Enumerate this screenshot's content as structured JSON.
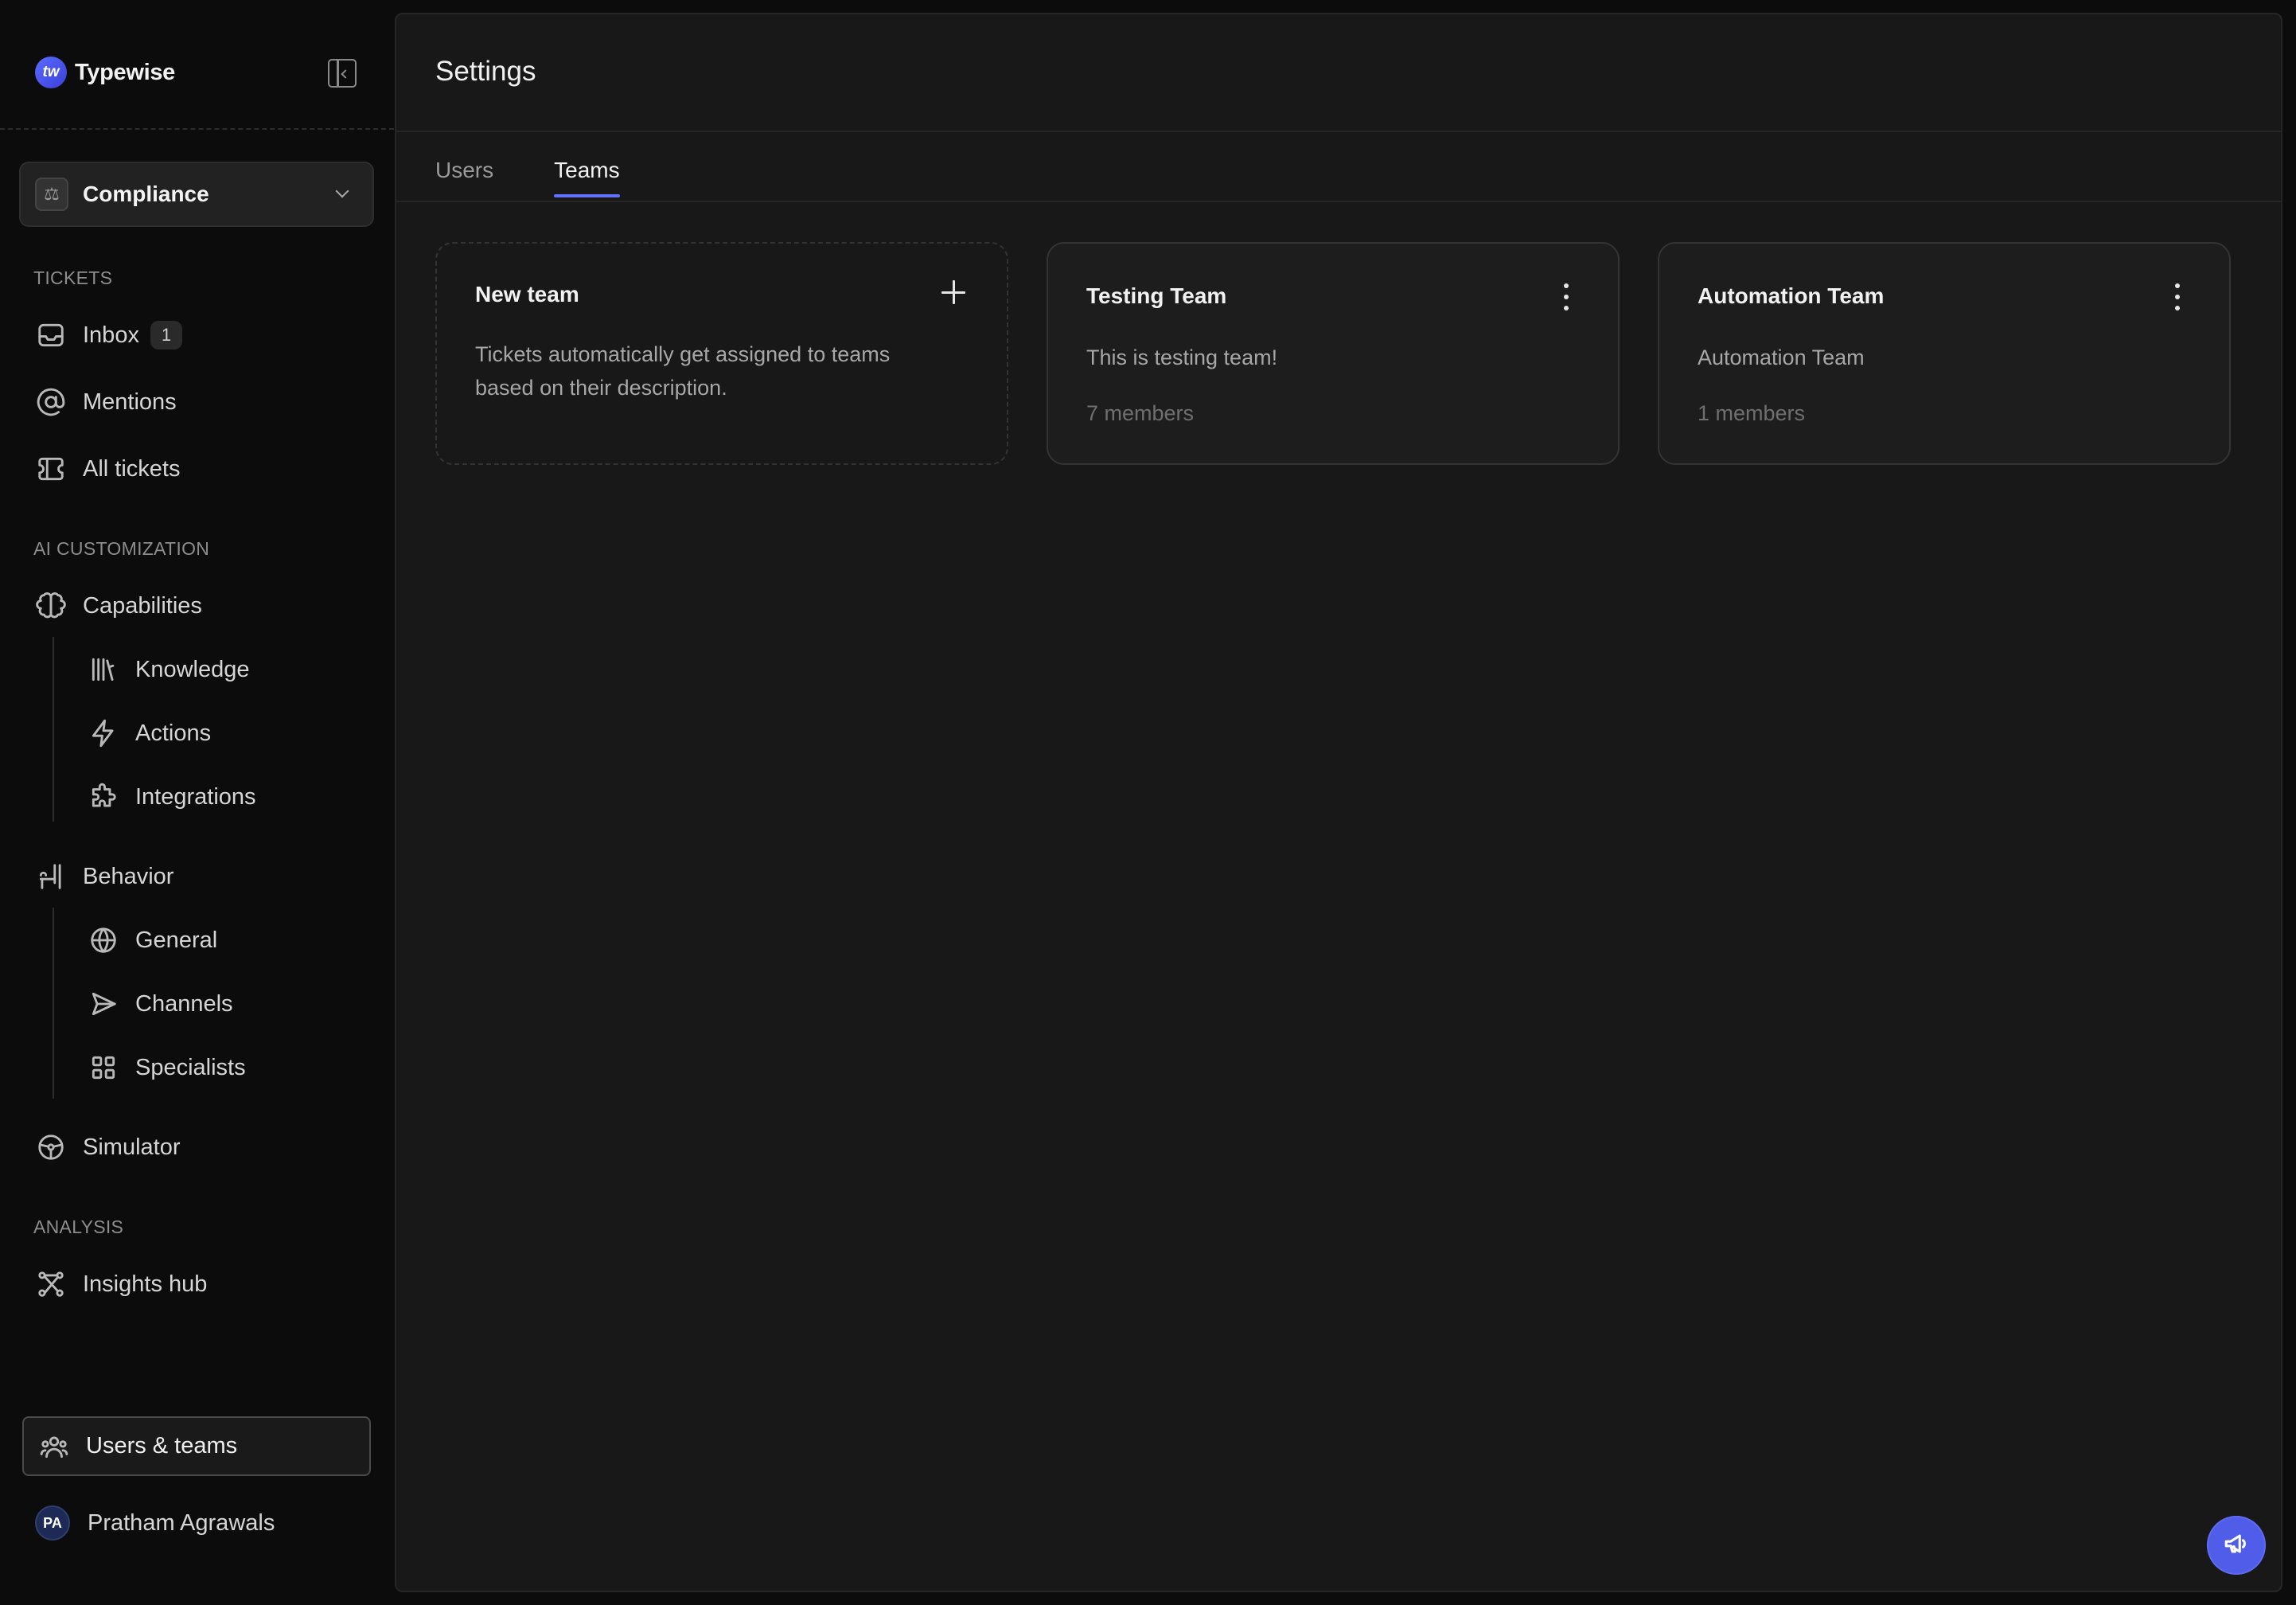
{
  "brand": {
    "name": "Typewise",
    "logo_text": "tw"
  },
  "workspace": {
    "label": "Compliance"
  },
  "sidebar": {
    "sections": {
      "tickets": "TICKETS",
      "ai": "AI CUSTOMIZATION",
      "analysis": "ANALYSIS"
    },
    "items": {
      "inbox": {
        "label": "Inbox",
        "badge": "1"
      },
      "mentions": {
        "label": "Mentions"
      },
      "all_tickets": {
        "label": "All tickets"
      },
      "capabilities": {
        "label": "Capabilities"
      },
      "knowledge": {
        "label": "Knowledge"
      },
      "actions": {
        "label": "Actions"
      },
      "integrations": {
        "label": "Integrations"
      },
      "behavior": {
        "label": "Behavior"
      },
      "general": {
        "label": "General"
      },
      "channels": {
        "label": "Channels"
      },
      "specialists": {
        "label": "Specialists"
      },
      "simulator": {
        "label": "Simulator"
      },
      "insights": {
        "label": "Insights hub"
      }
    },
    "users_teams": {
      "label": "Users & teams"
    },
    "user": {
      "initials": "PA",
      "name": "Pratham Agrawals"
    }
  },
  "main": {
    "title": "Settings",
    "tabs": [
      {
        "label": "Users",
        "active": false
      },
      {
        "label": "Teams",
        "active": true
      }
    ],
    "new_team": {
      "title": "New team",
      "description": "Tickets automatically get assigned to teams based on their description."
    },
    "teams": [
      {
        "name": "Testing Team",
        "description": "This is testing team!",
        "members": "7 members"
      },
      {
        "name": "Automation Team",
        "description": "Automation Team",
        "members": "1 members"
      }
    ]
  },
  "colors": {
    "accent": "#6270ff",
    "fab": "#4f5de8",
    "background": "#0c0c0c",
    "panel": "#181818"
  }
}
